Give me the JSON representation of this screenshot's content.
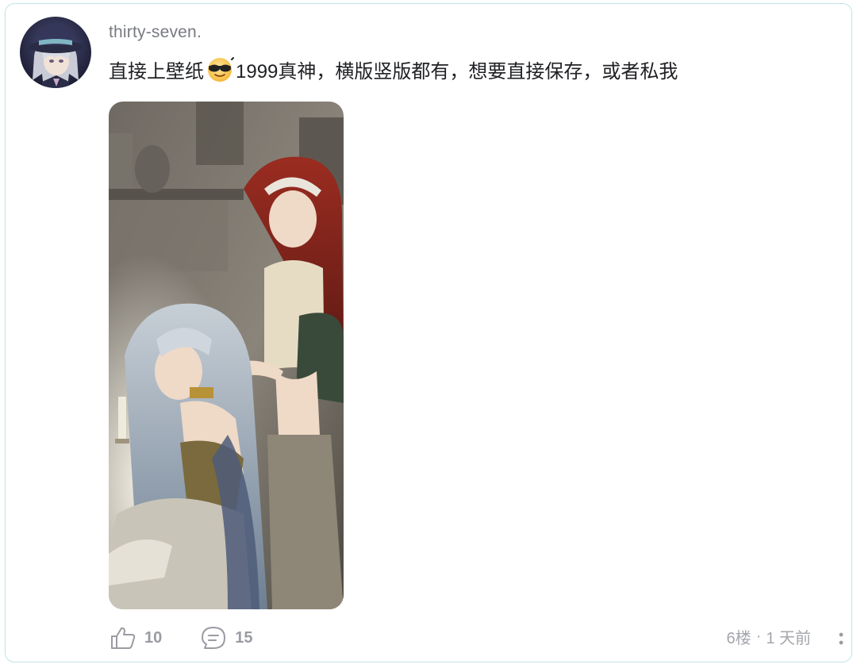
{
  "post": {
    "username": "thirty-seven.",
    "text_before_emoji": "直接上壁纸",
    "emoji_icon": "sunglasses-face-icon",
    "text_after_emoji": "1999真神，横版竖版都有，想要直接保存，或者私我",
    "likes": "10",
    "comments": "15",
    "floor": "6楼",
    "separator": "·",
    "time": "1 天前"
  },
  "colors": {
    "card_border": "#bfe3e7",
    "username": "#777a80",
    "meta": "#a4a6ac"
  }
}
